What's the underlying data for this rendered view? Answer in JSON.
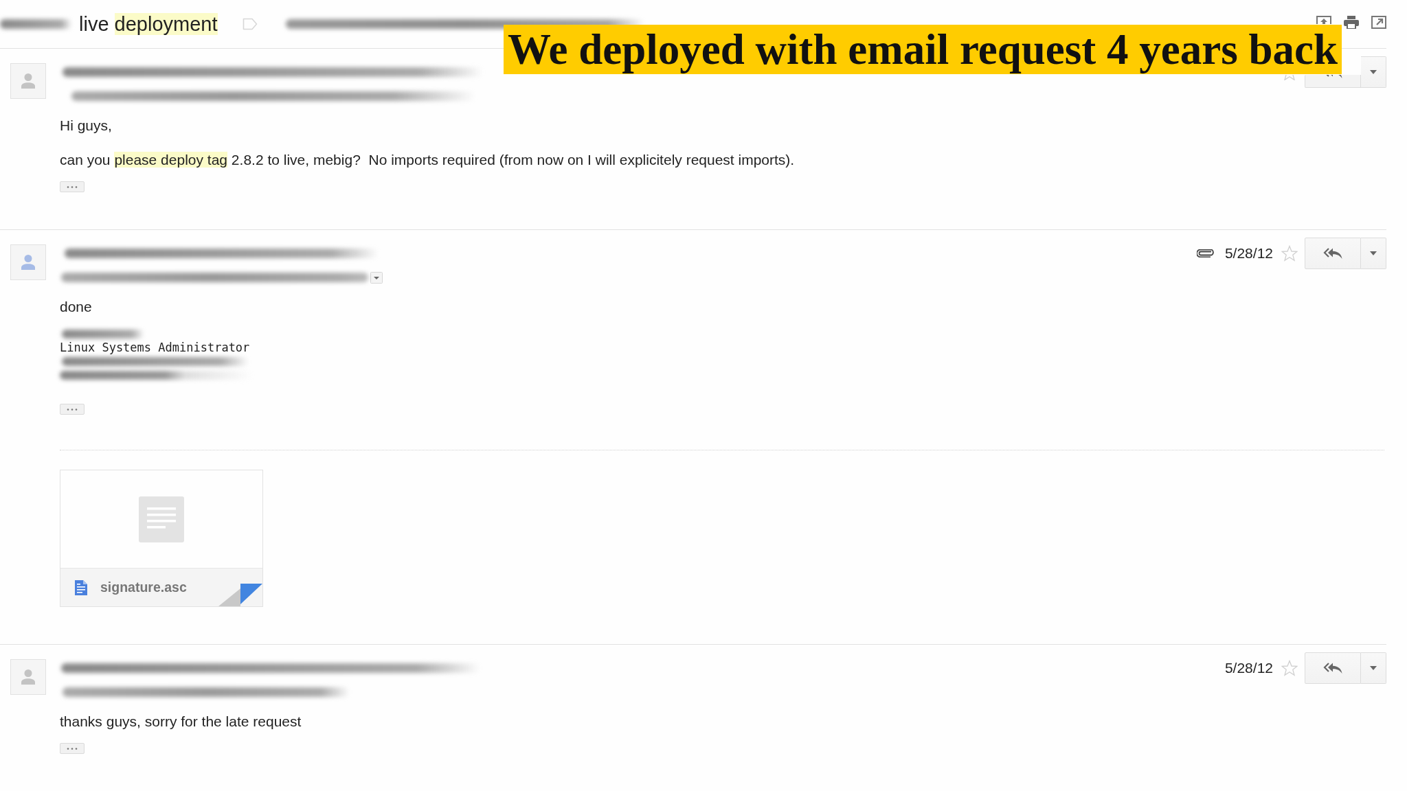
{
  "header": {
    "subject": [
      {
        "text": "live ",
        "highlighted": false
      },
      {
        "text": "deployment",
        "highlighted": true
      }
    ]
  },
  "caption": {
    "text": "We deployed with email request 4 years back"
  },
  "messages": [
    {
      "color": "#c3c3c3",
      "details_expander": false,
      "has_attachment": false,
      "starred": false,
      "body": [
        {
          "kind": "paragraph",
          "segments": [
            {
              "text": "Hi guys,",
              "highlighted": false
            }
          ]
        },
        {
          "kind": "paragraph",
          "segments": [
            {
              "text": "can you ",
              "highlighted": false
            },
            {
              "text": "please deploy tag",
              "highlighted": true
            },
            {
              "text": " 2.8.2 to live, mebig?  No imports required (from now on I will explicitely request imports).",
              "highlighted": false
            }
          ]
        }
      ],
      "show_trimmed": true
    },
    {
      "color": "#a6bbe6",
      "details_expander": true,
      "has_attachment": true,
      "date": "5/28/12",
      "starred": false,
      "body": [
        {
          "kind": "paragraph",
          "segments": [
            {
              "text": "done",
              "highlighted": false
            }
          ]
        },
        {
          "kind": "signature",
          "lines": [
            {
              "kind": "redacted"
            },
            {
              "kind": "mono",
              "text": "Linux Systems Administrator"
            },
            {
              "kind": "redacted"
            },
            {
              "kind": "redacted"
            }
          ]
        }
      ],
      "show_trimmed": true,
      "attachments": [
        {
          "name": "signature.asc"
        }
      ]
    },
    {
      "color": "#c3c3c3",
      "details_expander": false,
      "has_attachment": false,
      "date": "5/28/12",
      "starred": false,
      "body": [
        {
          "kind": "paragraph",
          "segments": [
            {
              "text": "thanks guys, sorry for the late request",
              "highlighted": false
            }
          ]
        }
      ],
      "show_trimmed": true
    }
  ]
}
